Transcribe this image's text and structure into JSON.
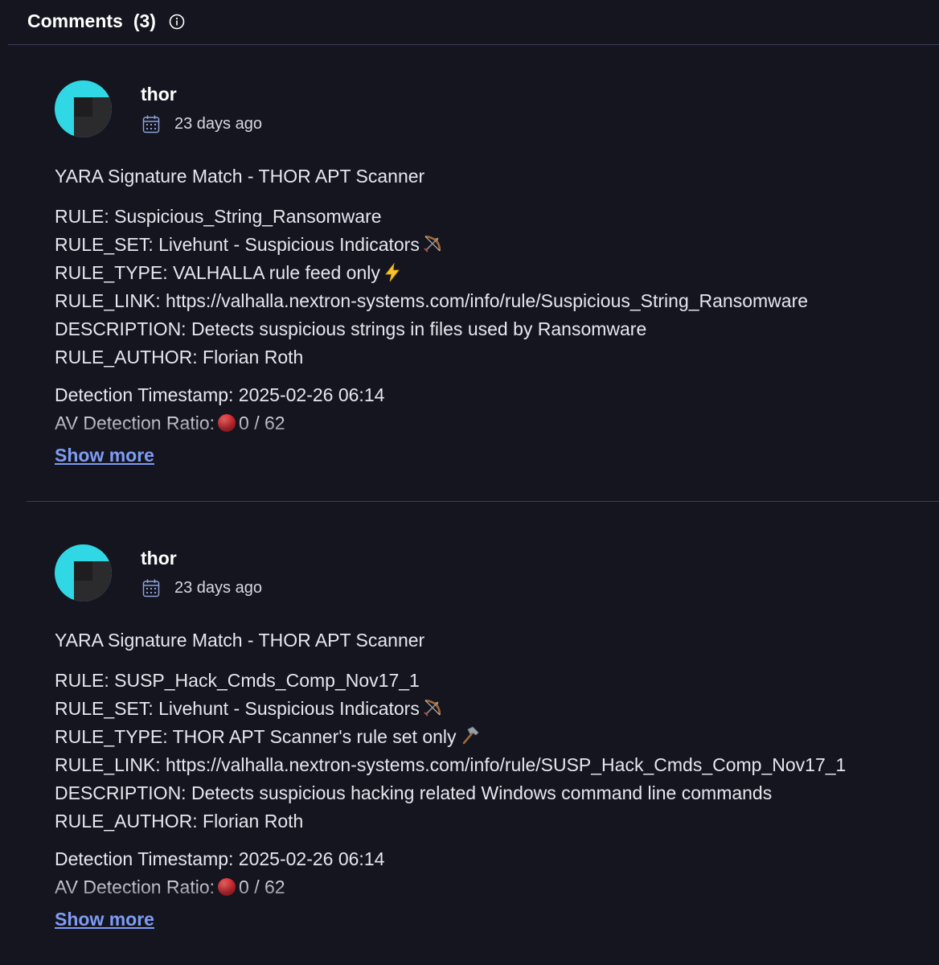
{
  "header": {
    "title": "Comments",
    "count": "(3)",
    "info_icon": "info-circle-icon"
  },
  "comments": [
    {
      "author": "thor",
      "date": "23 days ago",
      "title": "YARA Signature Match - THOR APT Scanner",
      "rule": "RULE: Suspicious_String_Ransomware",
      "rule_set": "RULE_SET: Livehunt - Suspicious Indicators",
      "rule_set_icon": "bow-and-arrow-icon",
      "rule_type": "RULE_TYPE: VALHALLA rule feed only",
      "rule_type_icon": "lightning-icon",
      "rule_link": "RULE_LINK: https://valhalla.nextron-systems.com/info/rule/Suspicious_String_Ransomware",
      "description": "DESCRIPTION: Detects suspicious strings in files used by Ransomware",
      "rule_author": "RULE_AUTHOR: Florian Roth",
      "detection_timestamp": "Detection Timestamp: 2025-02-26 06:14",
      "av_ratio_label": "AV Detection Ratio:",
      "av_ratio_value": "0 / 62",
      "show_more": "Show more"
    },
    {
      "author": "thor",
      "date": "23 days ago",
      "title": "YARA Signature Match - THOR APT Scanner",
      "rule": "RULE: SUSP_Hack_Cmds_Comp_Nov17_1",
      "rule_set": "RULE_SET: Livehunt - Suspicious Indicators",
      "rule_set_icon": "bow-and-arrow-icon",
      "rule_type": "RULE_TYPE: THOR APT Scanner's rule set only",
      "rule_type_icon": "hammer-icon",
      "rule_link": "RULE_LINK: https://valhalla.nextron-systems.com/info/rule/SUSP_Hack_Cmds_Comp_Nov17_1",
      "description": "DESCRIPTION: Detects suspicious hacking related Windows command line commands",
      "rule_author": "RULE_AUTHOR: Florian Roth",
      "detection_timestamp": "Detection Timestamp: 2025-02-26 06:14",
      "av_ratio_label": "AV Detection Ratio:",
      "av_ratio_value": "0 / 62",
      "show_more": "Show more"
    }
  ],
  "colors": {
    "background": "#14151f",
    "divider": "#38405a",
    "link": "#7f9cf5",
    "avatar_cyan": "#2fd8e4",
    "avatar_dark": "#2b2b2e"
  }
}
